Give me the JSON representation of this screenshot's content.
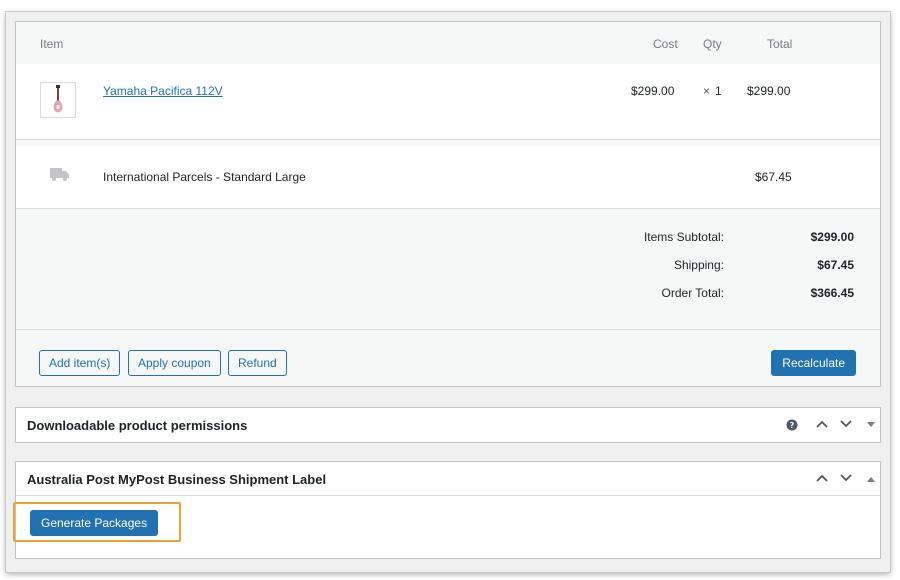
{
  "table": {
    "headers": {
      "item": "Item",
      "cost": "Cost",
      "qty": "Qty",
      "total": "Total"
    },
    "product": {
      "name": "Yamaha Pacifica 112V",
      "cost": "$299.00",
      "qty_symbol": "×",
      "qty": "1",
      "total": "$299.00"
    },
    "shipping": {
      "name": "International Parcels - Standard Large",
      "total": "$67.45"
    }
  },
  "totals": {
    "items_subtotal_label": "Items Subtotal:",
    "items_subtotal_value": "$299.00",
    "shipping_label": "Shipping:",
    "shipping_value": "$67.45",
    "order_total_label": "Order Total:",
    "order_total_value": "$366.45"
  },
  "actions": {
    "add_items": "Add item(s)",
    "apply_coupon": "Apply coupon",
    "refund": "Refund",
    "recalculate": "Recalculate"
  },
  "panels": {
    "downloadable": {
      "title": "Downloadable product permissions"
    },
    "auspost": {
      "title": "Australia Post MyPost Business Shipment Label",
      "generate_button": "Generate Packages"
    }
  },
  "colors": {
    "accent": "#2271b1",
    "highlight": "#f0a030"
  },
  "icons": {
    "help": "help-icon",
    "move_up": "chevron-up-icon",
    "move_down": "chevron-down-icon",
    "toggle": "toggle-triangle-icon",
    "shipping": "truck-icon"
  }
}
